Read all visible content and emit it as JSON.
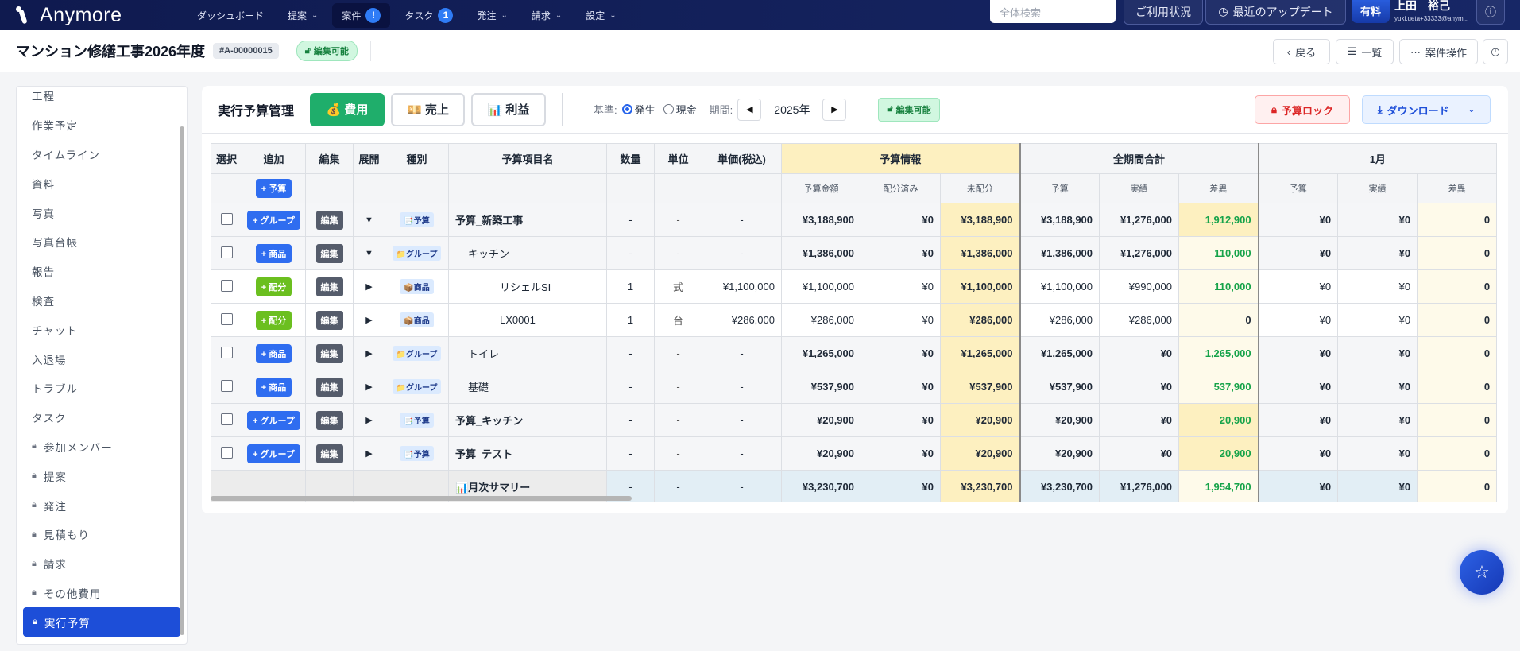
{
  "nav": {
    "brand": "Anymore",
    "menu": [
      {
        "label": "ダッシュボード",
        "chevron": false
      },
      {
        "label": "提案",
        "chevron": true
      },
      {
        "label": "案件",
        "badge": "!",
        "active": true
      },
      {
        "label": "タスク",
        "badge": "1"
      },
      {
        "label": "発注",
        "chevron": true
      },
      {
        "label": "請求",
        "chevron": true
      },
      {
        "label": "設定",
        "chevron": true
      }
    ],
    "search_placeholder": "全体検索",
    "usage_label": "ご利用状況",
    "updates_label": "最近のアップデート",
    "plan_label": "有料",
    "user_name": "上田　裕己",
    "user_email": "yuki.ueta+33333@anym..."
  },
  "header": {
    "title": "マンション修繕工事2026年度",
    "project_id": "#A-00000015",
    "status": "編集可能",
    "back_label": "戻る",
    "list_label": "一覧",
    "actions_label": "案件操作"
  },
  "sidebar": {
    "items": [
      {
        "label": "工程"
      },
      {
        "label": "作業予定"
      },
      {
        "label": "タイムライン"
      },
      {
        "label": "資料"
      },
      {
        "label": "写真"
      },
      {
        "label": "写真台帳"
      },
      {
        "label": "報告"
      },
      {
        "label": "検査"
      },
      {
        "label": "チャット"
      },
      {
        "label": "入退場"
      },
      {
        "label": "トラブル"
      },
      {
        "label": "タスク"
      },
      {
        "label": "参加メンバー",
        "locked": true
      },
      {
        "label": "提案",
        "locked": true
      },
      {
        "label": "発注",
        "locked": true
      },
      {
        "label": "見積もり",
        "locked": true
      },
      {
        "label": "請求",
        "locked": true
      },
      {
        "label": "その他費用",
        "locked": true
      },
      {
        "label": "実行予算",
        "locked": true,
        "active": true
      }
    ]
  },
  "toolbar": {
    "title": "実行予算管理",
    "tabs": [
      {
        "icon": "💰",
        "label": "費用",
        "active": true
      },
      {
        "icon": "💴",
        "label": "売上"
      },
      {
        "icon": "📊",
        "label": "利益"
      }
    ],
    "basis_label": "基準:",
    "basis_options": [
      {
        "label": "発生",
        "selected": true
      },
      {
        "label": "現金",
        "selected": false
      }
    ],
    "period_label": "期間:",
    "year": "2025年",
    "status": "編集可能",
    "lock_label": "予算ロック",
    "download_label": "ダウンロード"
  },
  "table": {
    "headers": [
      "選択",
      "追加",
      "編集",
      "展開",
      "種別",
      "予算項目名",
      "数量",
      "単位",
      "単価(税込)"
    ],
    "groups": [
      "予算情報",
      "全期間合計",
      "1月"
    ],
    "subheaders": [
      "予算金額",
      "配分済み",
      "未配分",
      "予算",
      "実績",
      "差異",
      "予算",
      "実績",
      "差異"
    ],
    "add_budget_label": "+ 予算",
    "edit_label": "編集",
    "rows": [
      {
        "add": "+ グループ",
        "add_color": "#2f6df0",
        "expand": "▼",
        "type_icon": "📑",
        "type": "予算",
        "name": "予算_新築工事",
        "level": 0,
        "kind": "budget",
        "qty": "-",
        "unit": "-",
        "price": "-",
        "values": [
          "¥3,188,900",
          "¥0",
          "¥3,188,900",
          "¥3,188,900",
          "¥1,276,000",
          "1,912,900",
          "¥0",
          "¥0",
          "0"
        ]
      },
      {
        "add": "+ 商品",
        "add_color": "#2f6df0",
        "expand": "▼",
        "type_icon": "📁",
        "type": "グループ",
        "name": "キッチン",
        "level": 1,
        "kind": "group",
        "qty": "-",
        "unit": "-",
        "price": "-",
        "values": [
          "¥1,386,000",
          "¥0",
          "¥1,386,000",
          "¥1,386,000",
          "¥1,276,000",
          "110,000",
          "¥0",
          "¥0",
          "0"
        ]
      },
      {
        "add": "+ 配分",
        "add_color": "#6bbf1f",
        "expand": "▶",
        "type_icon": "📦",
        "type": "商品",
        "name": "リシェルSI",
        "level": 2,
        "kind": "item",
        "qty": "1",
        "unit": "式",
        "price": "¥1,100,000",
        "values": [
          "¥1,100,000",
          "¥0",
          "¥1,100,000",
          "¥1,100,000",
          "¥990,000",
          "110,000",
          "¥0",
          "¥0",
          "0"
        ]
      },
      {
        "add": "+ 配分",
        "add_color": "#6bbf1f",
        "expand": "▶",
        "type_icon": "📦",
        "type": "商品",
        "name": "LX0001",
        "level": 2,
        "kind": "item",
        "qty": "1",
        "unit": "台",
        "price": "¥286,000",
        "values": [
          "¥286,000",
          "¥0",
          "¥286,000",
          "¥286,000",
          "¥286,000",
          "0",
          "¥0",
          "¥0",
          "0"
        ]
      },
      {
        "add": "+ 商品",
        "add_color": "#2f6df0",
        "expand": "▶",
        "type_icon": "📁",
        "type": "グループ",
        "name": "トイレ",
        "level": 1,
        "kind": "group",
        "qty": "-",
        "unit": "-",
        "price": "-",
        "values": [
          "¥1,265,000",
          "¥0",
          "¥1,265,000",
          "¥1,265,000",
          "¥0",
          "1,265,000",
          "¥0",
          "¥0",
          "0"
        ]
      },
      {
        "add": "+ 商品",
        "add_color": "#2f6df0",
        "expand": "▶",
        "type_icon": "📁",
        "type": "グループ",
        "name": "基礎",
        "level": 1,
        "kind": "group",
        "qty": "-",
        "unit": "-",
        "price": "-",
        "values": [
          "¥537,900",
          "¥0",
          "¥537,900",
          "¥537,900",
          "¥0",
          "537,900",
          "¥0",
          "¥0",
          "0"
        ]
      },
      {
        "add": "+ グループ",
        "add_color": "#2f6df0",
        "expand": "▶",
        "type_icon": "📑",
        "type": "予算",
        "name": "予算_キッチン",
        "level": 0,
        "kind": "budget",
        "qty": "-",
        "unit": "-",
        "price": "-",
        "values": [
          "¥20,900",
          "¥0",
          "¥20,900",
          "¥20,900",
          "¥0",
          "20,900",
          "¥0",
          "¥0",
          "0"
        ]
      },
      {
        "add": "+ グループ",
        "add_color": "#2f6df0",
        "expand": "▶",
        "type_icon": "📑",
        "type": "予算",
        "name": "予算_テスト",
        "level": 0,
        "kind": "budget",
        "qty": "-",
        "unit": "-",
        "price": "-",
        "values": [
          "¥20,900",
          "¥0",
          "¥20,900",
          "¥20,900",
          "¥0",
          "20,900",
          "¥0",
          "¥0",
          "0"
        ]
      }
    ],
    "summary": {
      "icon": "📊",
      "name": "月次サマリー",
      "qty": "-",
      "unit": "-",
      "price": "-",
      "values": [
        "¥3,230,700",
        "¥0",
        "¥3,230,700",
        "¥3,230,700",
        "¥1,276,000",
        "1,954,700",
        "¥0",
        "¥0",
        "0"
      ]
    }
  },
  "colors": {
    "positive": "#16a34a",
    "accent": "#1d4ed8",
    "fee_tab": "#1fae6b"
  }
}
